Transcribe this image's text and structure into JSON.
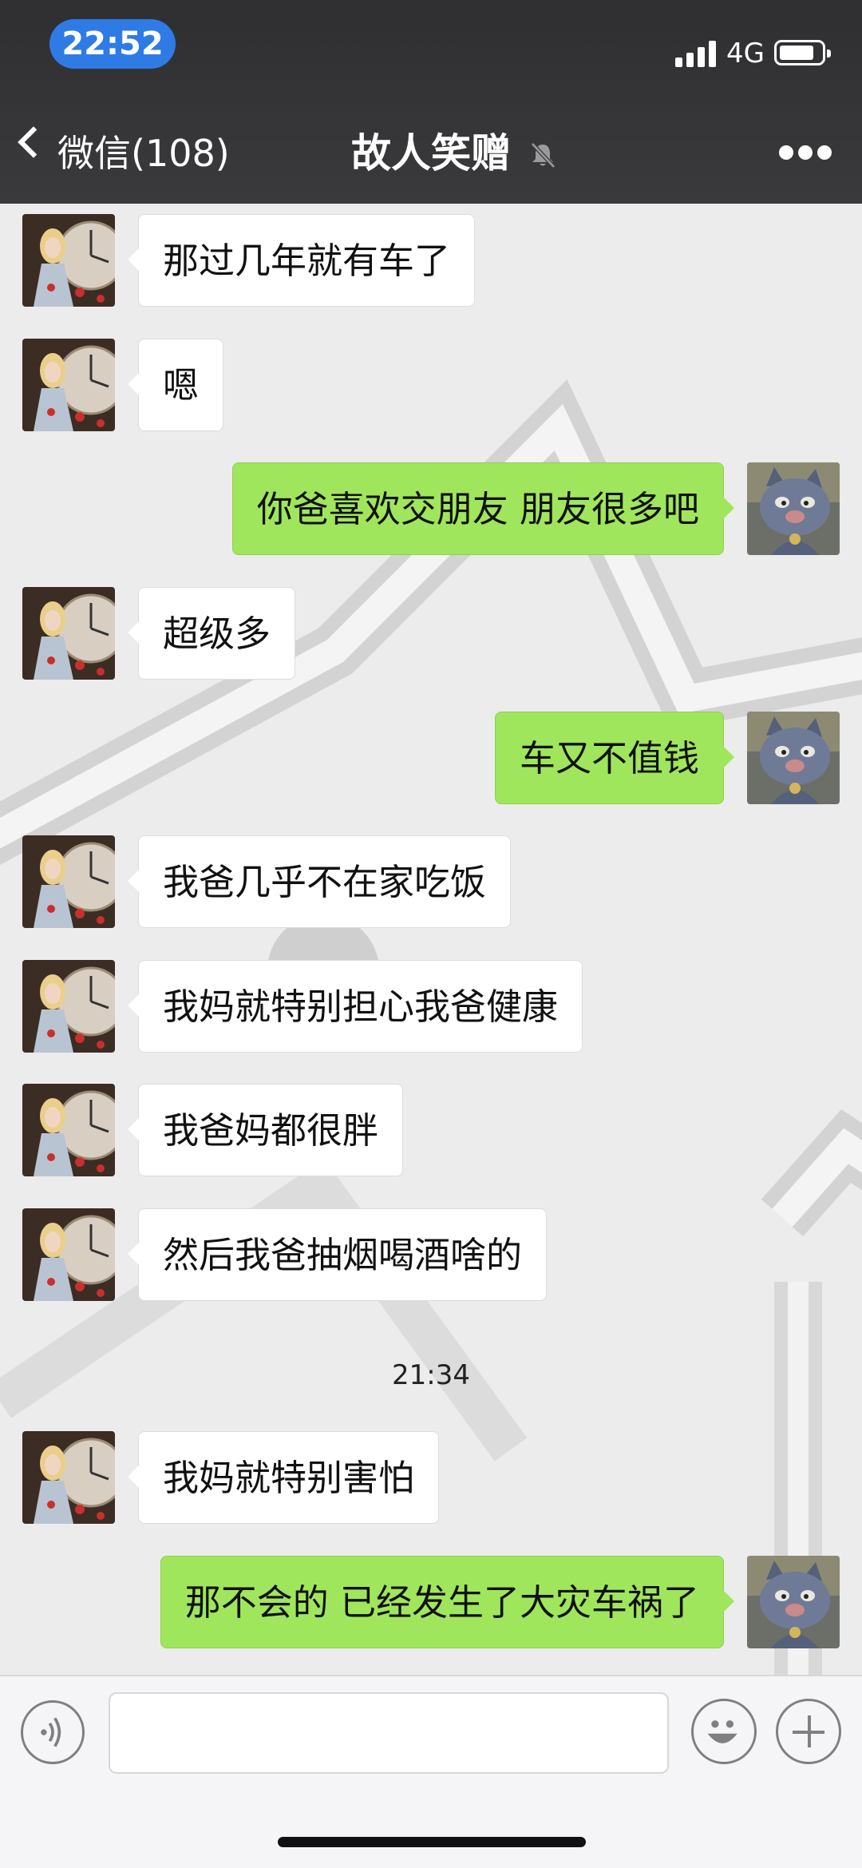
{
  "status_bar": {
    "time": "22:52",
    "network": "4G"
  },
  "nav": {
    "back_label": "微信(108)",
    "title": "故人笑赠"
  },
  "messages": [
    {
      "side": "left",
      "text": "那过几年就有车了"
    },
    {
      "side": "left",
      "text": "嗯"
    },
    {
      "side": "right",
      "text": "你爸喜欢交朋友  朋友很多吧"
    },
    {
      "side": "left",
      "text": "超级多"
    },
    {
      "side": "right",
      "text": "车又不值钱"
    },
    {
      "side": "left",
      "text": "我爸几乎不在家吃饭"
    },
    {
      "side": "left",
      "text": "我妈就特别担心我爸健康"
    },
    {
      "side": "left",
      "text": "我爸妈都很胖"
    },
    {
      "side": "left",
      "text": "然后我爸抽烟喝酒啥的"
    },
    {
      "side": "left",
      "text": "我妈就特别害怕"
    },
    {
      "side": "right",
      "text": "那不会的  已经发生了大灾车祸了"
    }
  ],
  "timestamp": "21:34",
  "input": {
    "value": ""
  },
  "colors": {
    "header_bg": "#2f2f31",
    "time_pill": "#2f7be6",
    "bubble_sent": "#a0e65c",
    "bubble_received": "#ffffff",
    "chat_bg": "#ececec"
  },
  "icons": {
    "back": "chevron-left-icon",
    "mute": "bell-muted-icon",
    "more": "ellipsis-icon",
    "voice": "voice-icon",
    "emoji": "emoji-icon",
    "plus": "plus-icon"
  }
}
